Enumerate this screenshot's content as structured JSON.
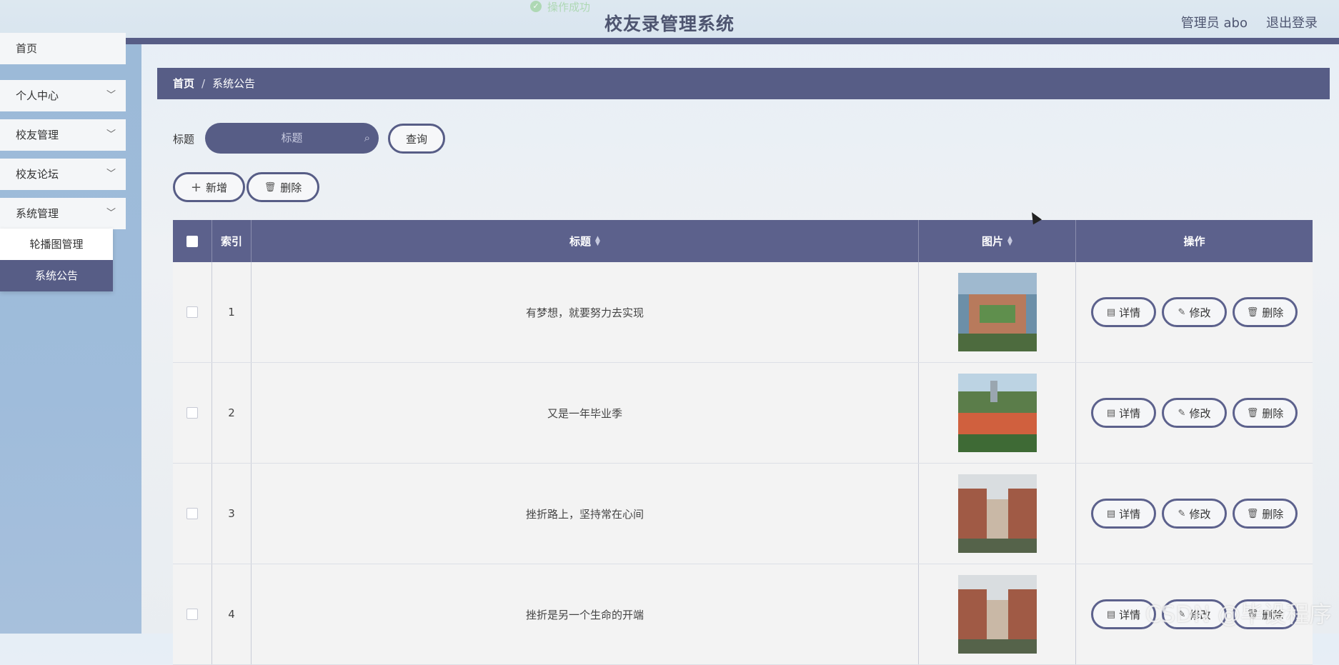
{
  "header": {
    "toast": "操作成功",
    "title": "校友录管理系统",
    "user": "管理员 abo",
    "logout": "退出登录"
  },
  "sidebar": {
    "items": [
      {
        "label": "首页"
      },
      {
        "label": "个人中心"
      },
      {
        "label": "校友管理"
      },
      {
        "label": "校友论坛"
      },
      {
        "label": "系统管理"
      }
    ],
    "submenu": [
      {
        "label": "轮播图管理"
      },
      {
        "label": "系统公告"
      }
    ]
  },
  "breadcrumb": {
    "home": "首页",
    "separator": "/",
    "current": "系统公告"
  },
  "search": {
    "label": "标题",
    "placeholder": "标题",
    "query_button": "查询"
  },
  "toolbar": {
    "add_label": "新增",
    "delete_label": "删除"
  },
  "table": {
    "columns": {
      "index": "索引",
      "title": "标题",
      "image": "图片",
      "actions": "操作"
    },
    "actions": {
      "detail": "详情",
      "edit": "修改",
      "delete": "删除"
    },
    "rows": [
      {
        "index": "1",
        "title": "有梦想，就要努力去实现"
      },
      {
        "index": "2",
        "title": "又是一年毕业季"
      },
      {
        "index": "3",
        "title": "挫折路上，坚持常在心间"
      },
      {
        "index": "4",
        "title": "挫折是另一个生命的开端"
      }
    ]
  },
  "watermark": "CSDN @毕设程序",
  "colors": {
    "primary": "#575d86",
    "header_bg": "#dde8f0",
    "sidebar_bg": "#9fbcdb"
  }
}
